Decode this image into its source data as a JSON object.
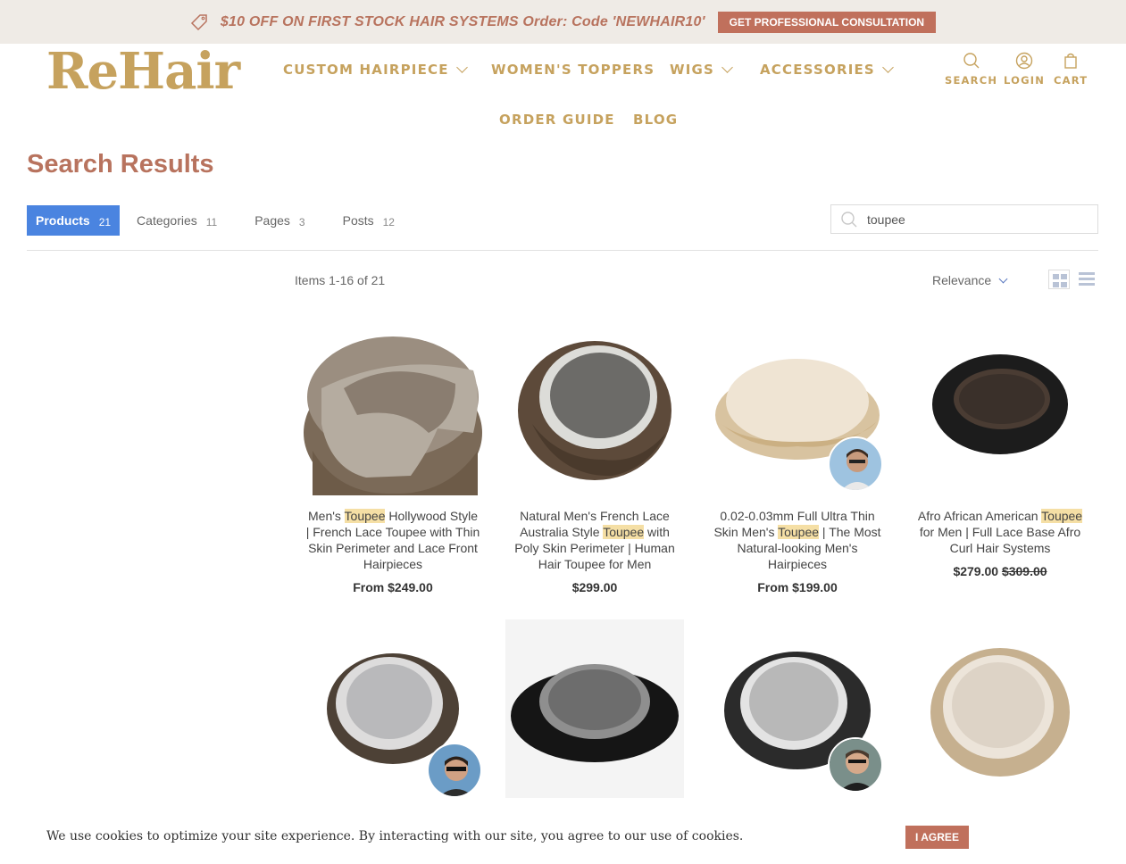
{
  "announcement": {
    "message": "$10 OFF ON FIRST STOCK HAIR SYSTEMS Order: Code 'NEWHAIR10'",
    "cta_label": "GET PROFESSIONAL CONSULTATION",
    "icon": "price-tag-icon"
  },
  "header": {
    "logo": "ReHair",
    "nav": [
      {
        "label": "CUSTOM HAIRPIECE",
        "has_dropdown": true
      },
      {
        "label": "WOMEN'S TOPPERS",
        "has_dropdown": false
      },
      {
        "label": "WIGS",
        "has_dropdown": true
      },
      {
        "label": "ACCESSORIES",
        "has_dropdown": true
      },
      {
        "label": "ORDER GUIDE",
        "has_dropdown": false
      },
      {
        "label": "BLOG",
        "has_dropdown": false
      }
    ],
    "utilities": [
      {
        "label": "SEARCH",
        "icon": "search-icon"
      },
      {
        "label": "LOGIN",
        "icon": "user-icon"
      },
      {
        "label": "CART",
        "icon": "bag-icon"
      }
    ]
  },
  "search": {
    "title": "Search Results",
    "tabs": [
      {
        "label": "Products",
        "count": "21",
        "active": true
      },
      {
        "label": "Categories",
        "count": "11",
        "active": false
      },
      {
        "label": "Pages",
        "count": "3",
        "active": false
      },
      {
        "label": "Posts",
        "count": "12",
        "active": false
      }
    ],
    "query": "toupee",
    "items_count": "Items 1-16 of 21",
    "sort_label": "Relevance"
  },
  "products": [
    {
      "title_parts": [
        "Men's ",
        "Toupee",
        " Hollywood Style | French Lace Toupee with Thin Skin Perimeter and Lace Front Hairpieces"
      ],
      "price": "From $249.00",
      "compare_price": ""
    },
    {
      "title_parts": [
        "Natural Men's French Lace Australia Style ",
        "Toupee",
        " with Poly Skin Perimeter | Human Hair Toupee for Men"
      ],
      "price": "$299.00",
      "compare_price": ""
    },
    {
      "title_parts": [
        "0.02-0.03mm Full Ultra Thin Skin Men's ",
        "Toupee",
        " | The Most Natural-looking Men's Hairpieces"
      ],
      "price": "From $199.00",
      "compare_price": ""
    },
    {
      "title_parts": [
        "Afro African American ",
        "Toupee",
        " for Men | Full Lace Base Afro Curl Hair Systems"
      ],
      "price": "$279.00",
      "compare_price": "$309.00"
    },
    {
      "title_parts": [
        "",
        "",
        ""
      ],
      "price": "",
      "compare_price": ""
    },
    {
      "title_parts": [
        "",
        "",
        ""
      ],
      "price": "",
      "compare_price": ""
    },
    {
      "title_parts": [
        "",
        "",
        ""
      ],
      "price": "",
      "compare_price": ""
    },
    {
      "title_parts": [
        "",
        "",
        ""
      ],
      "price": "",
      "compare_price": ""
    }
  ],
  "cookie": {
    "text": "We use cookies to optimize your site experience. By interacting with our site, you agree to our use of cookies.",
    "button": "I AGREE"
  },
  "colors": {
    "brand_gold": "#c6a25e",
    "accent_terracotta": "#c0705c",
    "active_tab_blue": "#4a84e0",
    "highlight": "#f5dfa5"
  }
}
